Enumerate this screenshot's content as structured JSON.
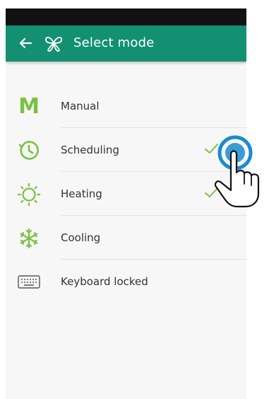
{
  "appbar": {
    "back_icon": "arrow-left-icon",
    "logo_icon": "butterfly-logo-icon",
    "title": "Select mode"
  },
  "modes": [
    {
      "icon": "manual-m-icon",
      "label": "Manual",
      "selected": false
    },
    {
      "icon": "clock-icon",
      "label": "Scheduling",
      "selected": true
    },
    {
      "icon": "sun-icon",
      "label": "Heating",
      "selected": true
    },
    {
      "icon": "snowflake-icon",
      "label": "Cooling",
      "selected": false
    },
    {
      "icon": "keyboard-icon",
      "label": "Keyboard locked",
      "selected": false
    }
  ],
  "colors": {
    "appbar": "#139072",
    "accent_green": "#7ac143",
    "check_green": "#7ac143",
    "tap_ring": "#1a8bd0"
  }
}
